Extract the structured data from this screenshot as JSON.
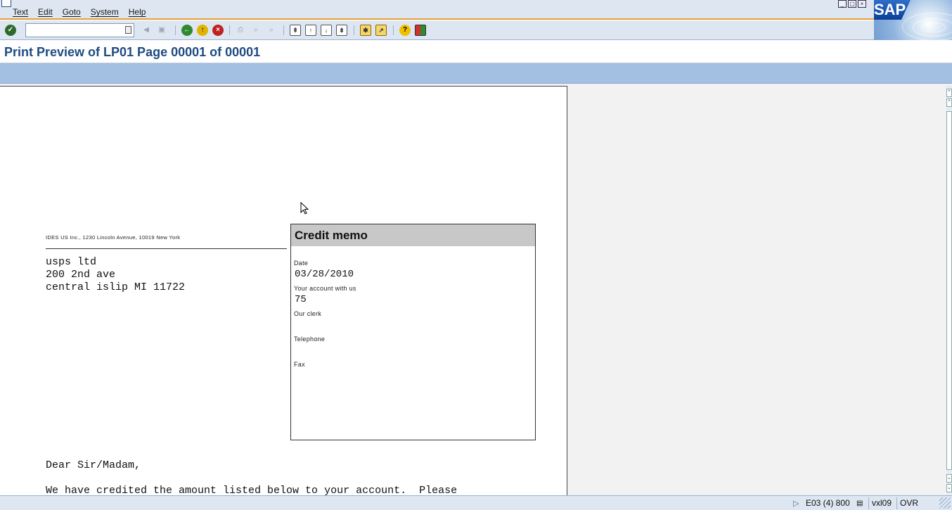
{
  "menu": {
    "items": [
      "Text",
      "Edit",
      "Goto",
      "System",
      "Help"
    ]
  },
  "logo": {
    "text": "SAP"
  },
  "toolbar": {
    "command_value": ""
  },
  "page": {
    "title": "Print Preview of LP01 Page 00001 of 00001"
  },
  "document": {
    "sender_line": "IDES US Inc., 1230 Lincoln Avenue, 10019 New York",
    "address": [
      "usps ltd",
      "200 2nd ave",
      "central islip MI  11722"
    ],
    "info_box": {
      "title": "Credit memo",
      "date_label": "Date",
      "date_value": "03/28/2010",
      "account_label": "Your account with us",
      "account_value": "75",
      "clerk_label": "Our clerk",
      "telephone_label": "Telephone",
      "fax_label": "Fax"
    },
    "salutation": "Dear Sir/Madam,",
    "body_line": "We have credited the amount listed below to your account.  Please"
  },
  "statusbar": {
    "system": "E03 (4) 800",
    "server": "vxl09",
    "mode": "OVR"
  },
  "colors": {
    "title": "#1d4b82",
    "accent": "#e8a33c",
    "app_toolbar": "#a3c0e3"
  }
}
